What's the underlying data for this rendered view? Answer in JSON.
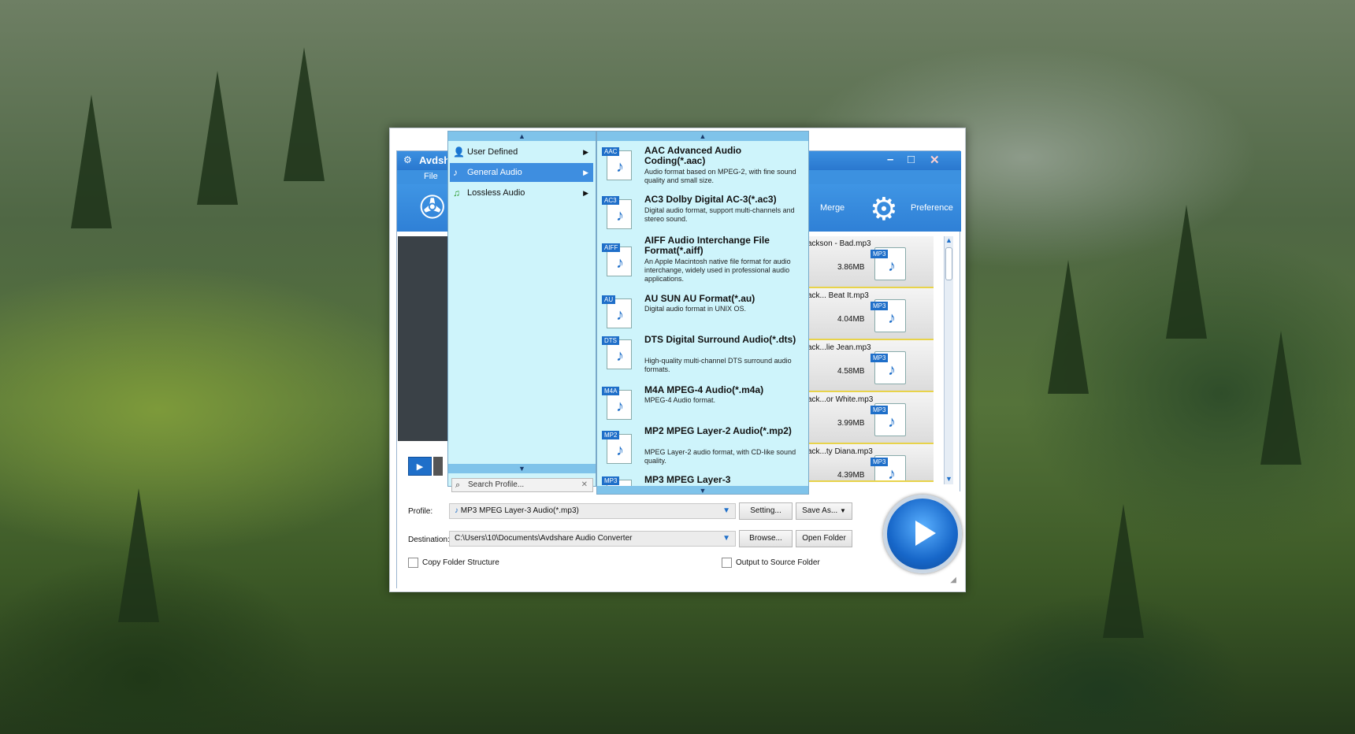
{
  "window": {
    "title": "Avdsh",
    "menu": {
      "file": "File"
    },
    "toolbar": {
      "merge": "Merge",
      "preference": "Preference"
    }
  },
  "files": [
    {
      "name": "ackson - Bad.mp3",
      "size": "3.86MB",
      "tag": "MP3"
    },
    {
      "name": "ack... Beat It.mp3",
      "size": "4.04MB",
      "tag": "MP3"
    },
    {
      "name": "ack...lie Jean.mp3",
      "size": "4.58MB",
      "tag": "MP3"
    },
    {
      "name": "ack...or White.mp3",
      "size": "3.99MB",
      "tag": "MP3"
    },
    {
      "name": "ack...ty Diana.mp3",
      "size": "4.39MB",
      "tag": "MP3"
    }
  ],
  "bottom": {
    "profile_label": "Profile:",
    "profile_value": "MP3 MPEG Layer-3 Audio(*.mp3)",
    "setting_button": "Setting...",
    "save_as_button": "Save As...",
    "destination_label": "Destination:",
    "destination_value": "C:\\Users\\10\\Documents\\Avdshare Audio Converter",
    "browse_button": "Browse...",
    "open_folder_button": "Open Folder",
    "copy_folder_structure": "Copy Folder Structure",
    "output_to_source": "Output to Source Folder"
  },
  "categories": [
    {
      "label": "User Defined",
      "icon": "user-icon"
    },
    {
      "label": "General Audio",
      "icon": "note-icon",
      "selected": true
    },
    {
      "label": "Lossless Audio",
      "icon": "note-icon"
    }
  ],
  "search_placeholder": "Search Profile...",
  "formats": [
    {
      "tag": "AAC",
      "name": "AAC Advanced Audio Coding(*.aac)",
      "desc": "Audio format based on MPEG-2, with fine sound quality and small size."
    },
    {
      "tag": "AC3",
      "name": "AC3 Dolby Digital AC-3(*.ac3)",
      "desc": "Digital audio format, support multi-channels and stereo sound."
    },
    {
      "tag": "AIFF",
      "name": "AIFF Audio Interchange File Format(*.aiff)",
      "desc": "An Apple Macintosh native file format for audio interchange, widely used in professional audio applications."
    },
    {
      "tag": "AU",
      "name": "AU SUN AU Format(*.au)",
      "desc": "Digital audio format in UNIX OS."
    },
    {
      "tag": "DTS",
      "name": "DTS Digital Surround Audio(*.dts)",
      "desc": "High-quality multi-channel DTS surround audio formats."
    },
    {
      "tag": "M4A",
      "name": "M4A MPEG-4 Audio(*.m4a)",
      "desc": "MPEG-4 Audio format."
    },
    {
      "tag": "MP2",
      "name": "MP2 MPEG Layer-2 Audio(*.mp2)",
      "desc": "MPEG Layer-2 audio format, with CD-like sound quality."
    },
    {
      "tag": "MP3",
      "name": "MP3 MPEG Layer-3",
      "desc": ""
    }
  ],
  "colors": {
    "accent": "#2f80d6",
    "selected": "#3e8ee0",
    "dropdown_bg": "#cef4fb",
    "highlight": "#e8d34a"
  }
}
